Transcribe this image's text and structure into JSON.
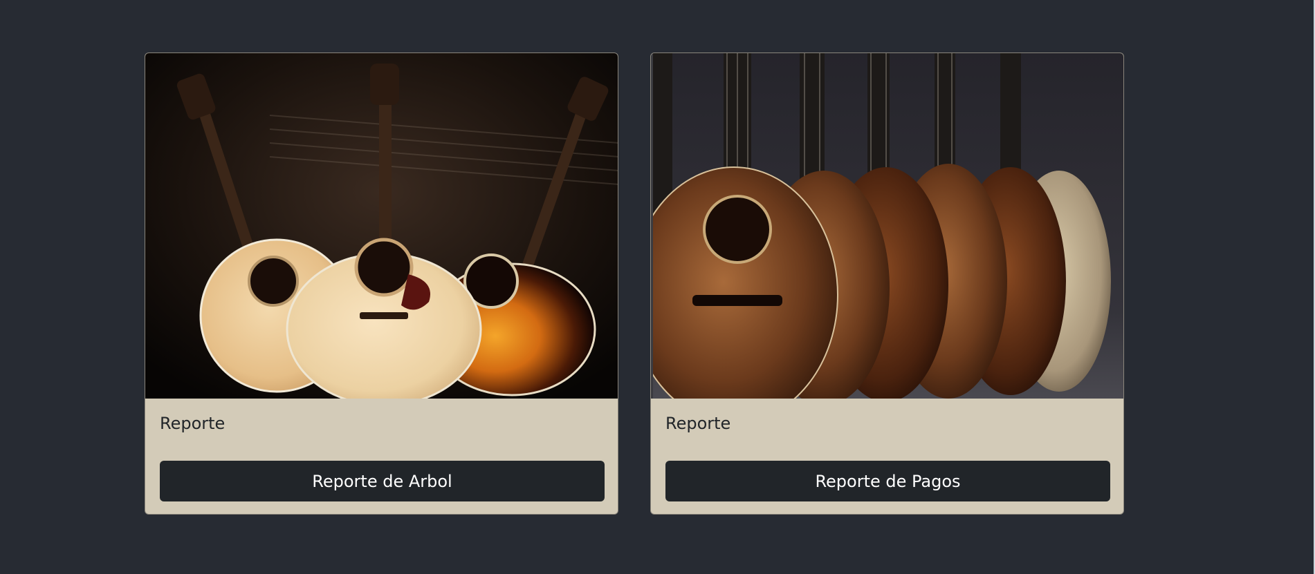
{
  "cards": [
    {
      "image": "acoustic-guitars-trio-image",
      "title": "Reporte",
      "button_label": "Reporte de Arbol"
    },
    {
      "image": "acoustic-guitars-row-image",
      "title": "Reporte",
      "button_label": "Reporte de Pagos"
    }
  ],
  "colors": {
    "page_background": "#272b33",
    "card_background": "#d3cbb8",
    "button_background": "#212529",
    "button_text": "#ffffff",
    "title_text": "#212529"
  }
}
